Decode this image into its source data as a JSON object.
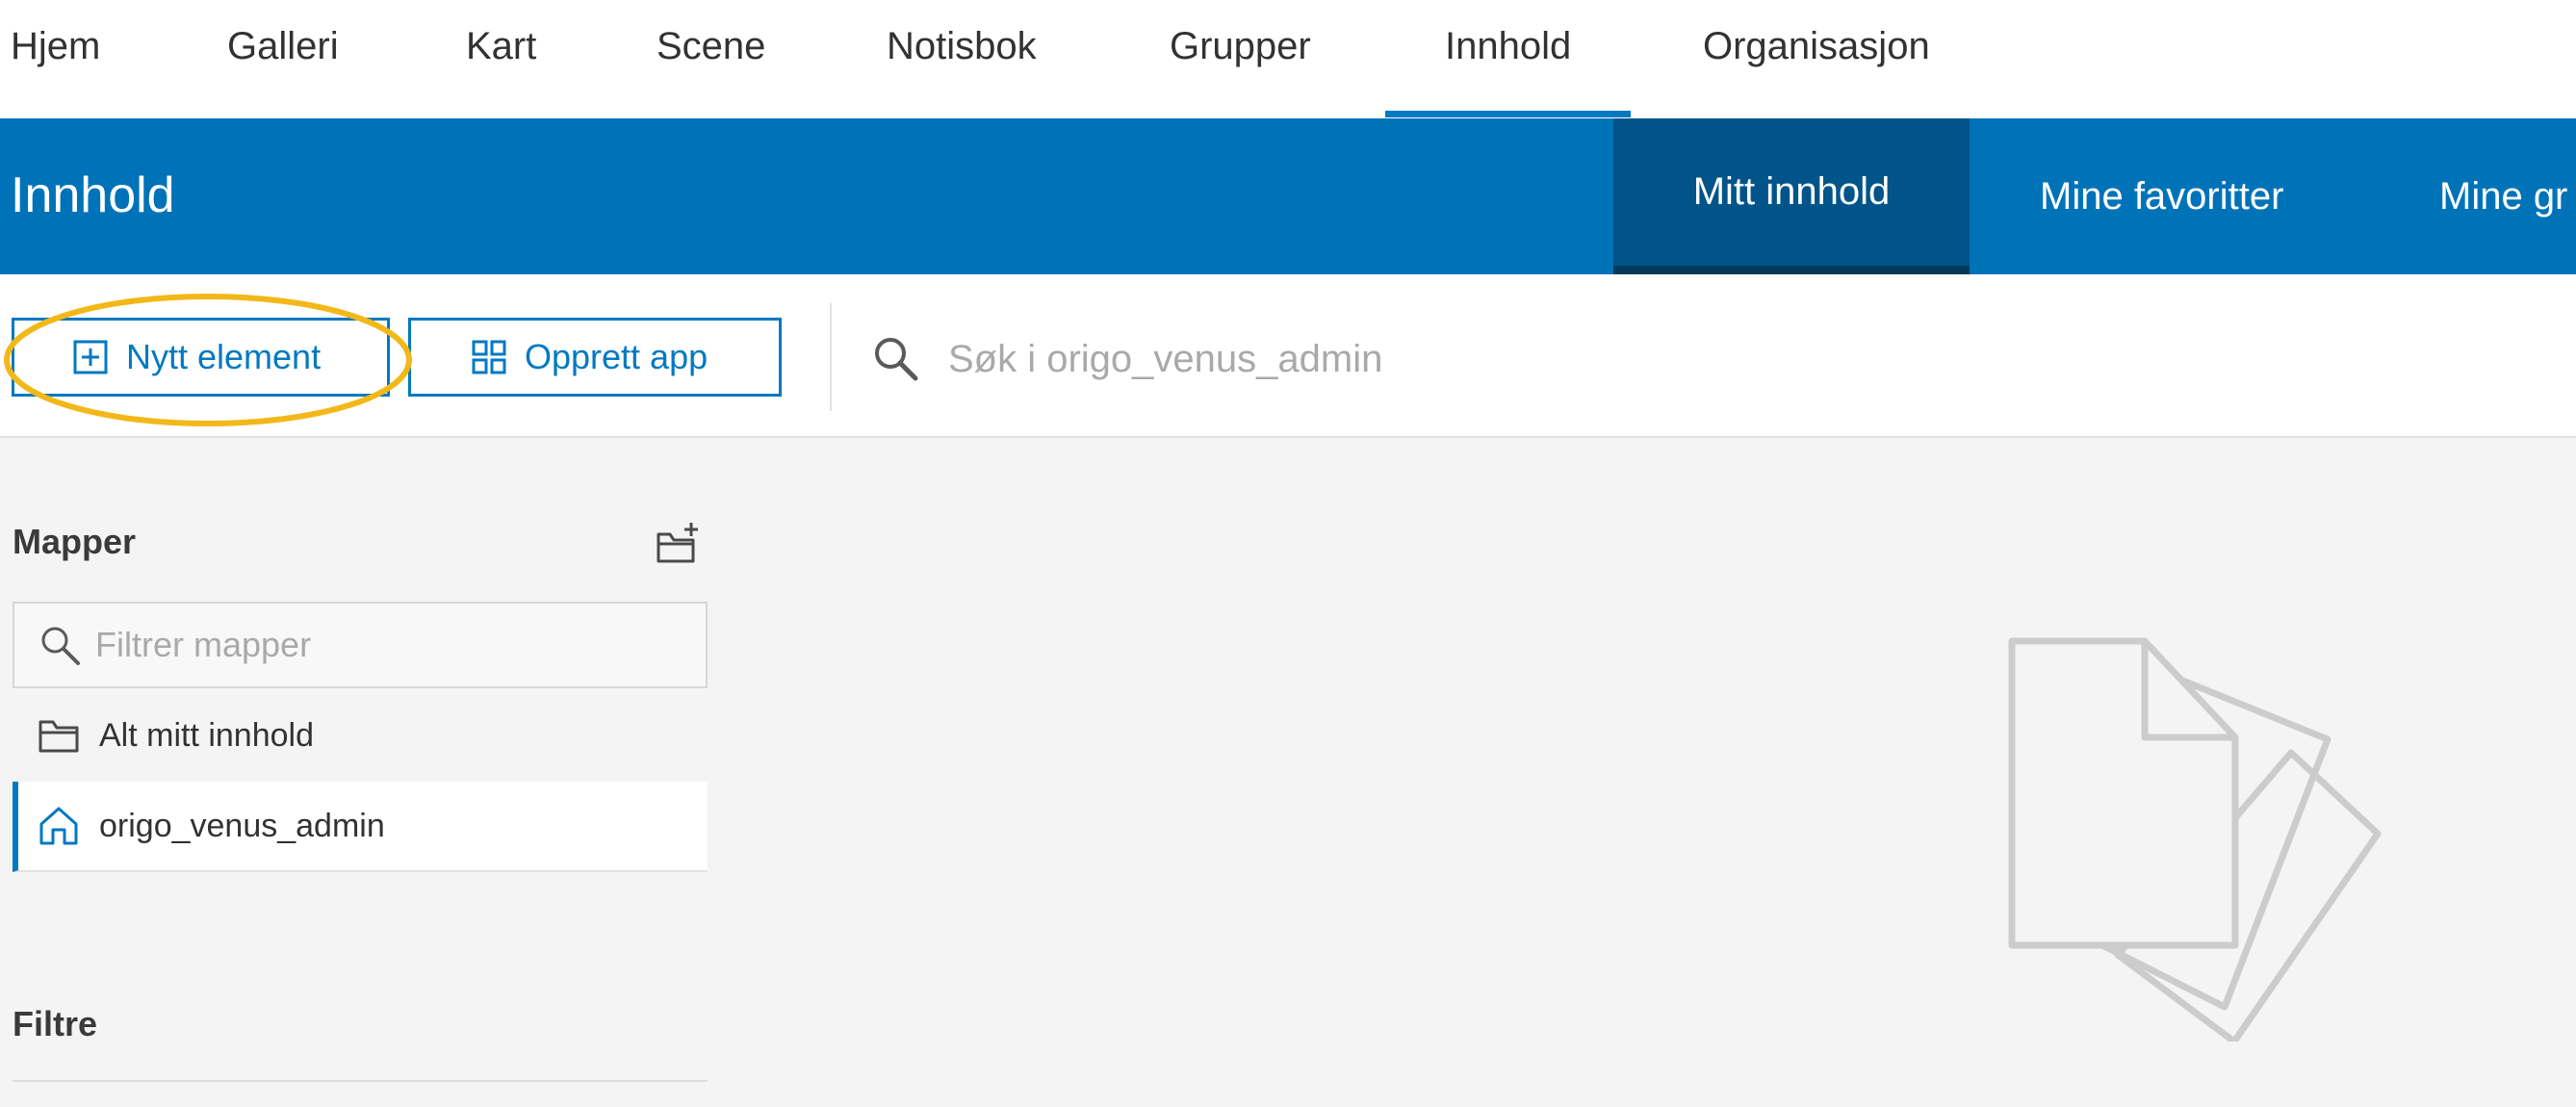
{
  "top_nav": {
    "items": [
      "Hjem",
      "Galleri",
      "Kart",
      "Scene",
      "Notisbok",
      "Grupper",
      "Innhold",
      "Organisasjon"
    ],
    "active": "Innhold"
  },
  "header": {
    "title": "Innhold",
    "tabs": [
      "Mitt innhold",
      "Mine favoritter",
      "Mine gr"
    ],
    "active_tab": "Mitt innhold"
  },
  "toolbar": {
    "new_item_label": "Nytt element",
    "create_app_label": "Opprett app",
    "search_placeholder": "Søk i origo_venus_admin",
    "search_value": ""
  },
  "sidebar": {
    "folders_title": "Mapper",
    "filter_placeholder": "Filtrer mapper",
    "folders": [
      "Alt mitt innhold",
      "origo_venus_admin"
    ],
    "selected_folder": "origo_venus_admin",
    "filters_title": "Filtre"
  },
  "icons": {
    "new_item": "plus-square-icon",
    "create_app": "grid-icon",
    "search": "search-icon",
    "new_folder": "new-folder-icon",
    "filter": "search-icon",
    "all_content": "folder-icon",
    "user_folder": "home-icon",
    "empty_state": "documents-icon"
  },
  "colors": {
    "brand_blue": "#0073b8",
    "active_tab_bg": "#005489",
    "accent": "#0079c1",
    "highlight": "#f2b819"
  }
}
